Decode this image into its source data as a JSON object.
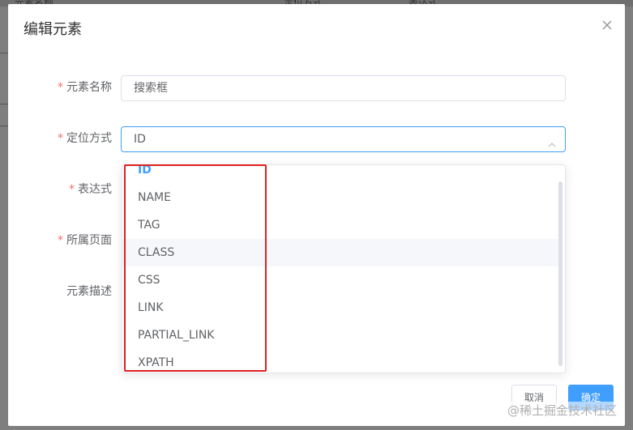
{
  "background": {
    "columns": [
      "元素名称",
      "定位方式",
      "表达式"
    ]
  },
  "dialog": {
    "title": "编辑元素",
    "close_icon": "close-icon"
  },
  "form": {
    "required_mark": "*",
    "fields": [
      {
        "label": "元素名称",
        "required": true,
        "value": "搜索框"
      },
      {
        "label": "定位方式",
        "required": true,
        "value": "ID"
      },
      {
        "label": "表达式",
        "required": true
      },
      {
        "label": "所属页面",
        "required": true
      },
      {
        "label": "元素描述",
        "required": false
      }
    ]
  },
  "dropdown": {
    "options": [
      "ID",
      "NAME",
      "TAG",
      "CLASS",
      "CSS",
      "LINK",
      "PARTIAL_LINK",
      "XPATH"
    ],
    "selected": "ID",
    "hovered": "CLASS"
  },
  "footer": {
    "cancel_label": "取消",
    "confirm_label": "确定"
  },
  "watermark": "@稀土掘金技术社区",
  "colors": {
    "accent": "#409eff",
    "required": "#f56c6c",
    "highlight_box": "#e02020"
  }
}
